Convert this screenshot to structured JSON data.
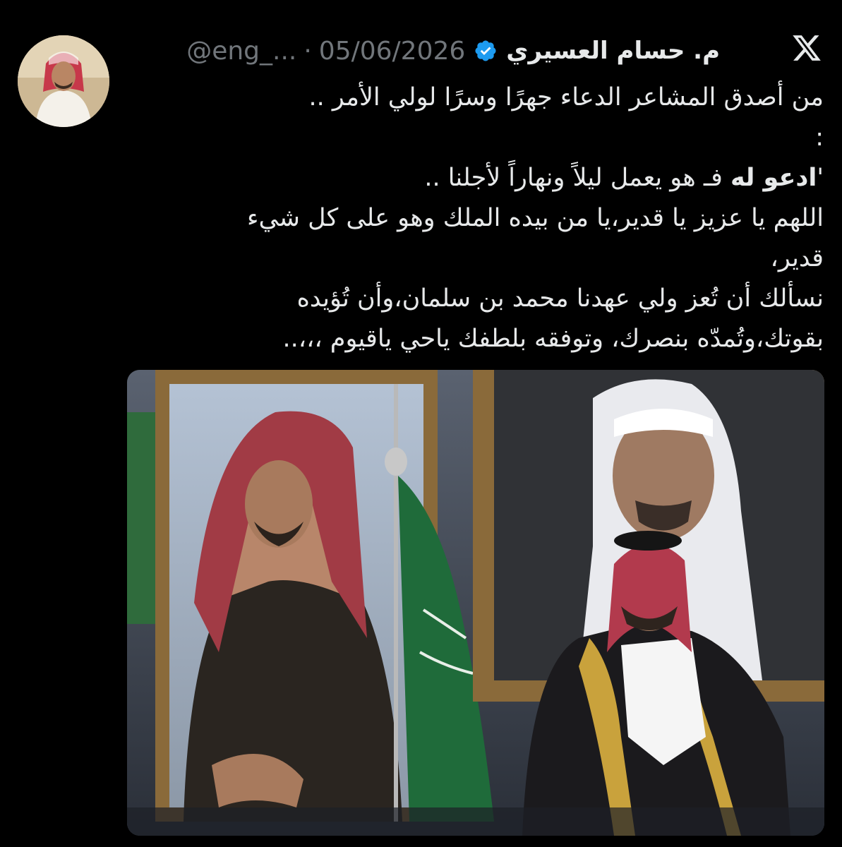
{
  "author": {
    "name": "م. حسام العسيري",
    "handle": "@eng_...",
    "separator": "·",
    "date": "05/06/2026"
  },
  "tweet": {
    "line1": "من أصدق المشاعر الدعاء جهرًا وسرًا لولي الأمر ..",
    "line2": ":",
    "line3_bold": "ادعو له",
    "line3_rest": " فـ هو يعمل ليلاً ونهاراً لأجلنا ..",
    "line3_quote": "'",
    "line4": "اللهم يا عزيز يا قدير،يا من بيده الملك وهو على كل شيء",
    "line5": "قدير،",
    "line6": "نسألك أن تُعز ولي عهدنا محمد بن سلمان،وأن تُؤيده",
    "line7": "بقوتك،وتُمدّه بنصرك، وتوفقه بلطفك ياحي ياقيوم ،،،.."
  },
  "icons": {
    "verified": "verified-badge-icon",
    "x_logo": "x-logo-icon"
  },
  "colors": {
    "background": "#000000",
    "text": "#e7e9ea",
    "muted": "#71767b",
    "verified": "#1d9bf0"
  }
}
